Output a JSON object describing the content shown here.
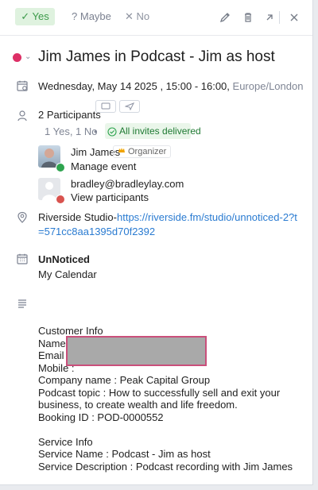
{
  "toolbar": {
    "yes_label": "Yes",
    "maybe_label": "Maybe",
    "no_label": "No"
  },
  "event": {
    "title": "Jim James in Podcast - Jim as host",
    "date_line": "Wednesday, May 14 2025 , 15:00 - 16:00,",
    "timezone": "Europe/London",
    "color": "#dd2f66"
  },
  "participants": {
    "title": "2 Participants",
    "summary": "1 Yes, 1 No",
    "dot": "•",
    "delivered": "All invites delivered",
    "people": [
      {
        "name": "Jim James",
        "badge": "Organizer",
        "action": "Manage event"
      },
      {
        "name": "bradley@bradleylay.com",
        "action": "View participants"
      }
    ]
  },
  "location": {
    "text": "Riverside Studio-",
    "link": "https://riverside.fm/studio/unnoticed-2?t=571cc8aa1395d70f2392"
  },
  "calendar": {
    "name": "UnNoticed",
    "subtitle": "My Calendar"
  },
  "description": {
    "text": "Customer Info\nName :\nEmail :\nMobile :\nCompany name : Peak Capital Group\nPodcast topic : How to successfully sell and exit your business, to create wealth and life freedom.\nBooking ID : POD-0000552\n\nService Info\nService Name : Podcast - Jim as host\nService Description : Podcast recording with Jim James"
  },
  "icons": {
    "toolbar": [
      "check-icon",
      "question-icon",
      "close-icon",
      "edit-icon",
      "trash-icon",
      "open-external-icon",
      "close-panel-icon"
    ],
    "rows": [
      "calendar-date-icon",
      "user-icon",
      "location-pin-icon",
      "calendar-grid-icon",
      "description-lines-icon"
    ],
    "others": [
      "message-icon",
      "send-icon",
      "crown-icon",
      "check-circle-icon"
    ]
  }
}
